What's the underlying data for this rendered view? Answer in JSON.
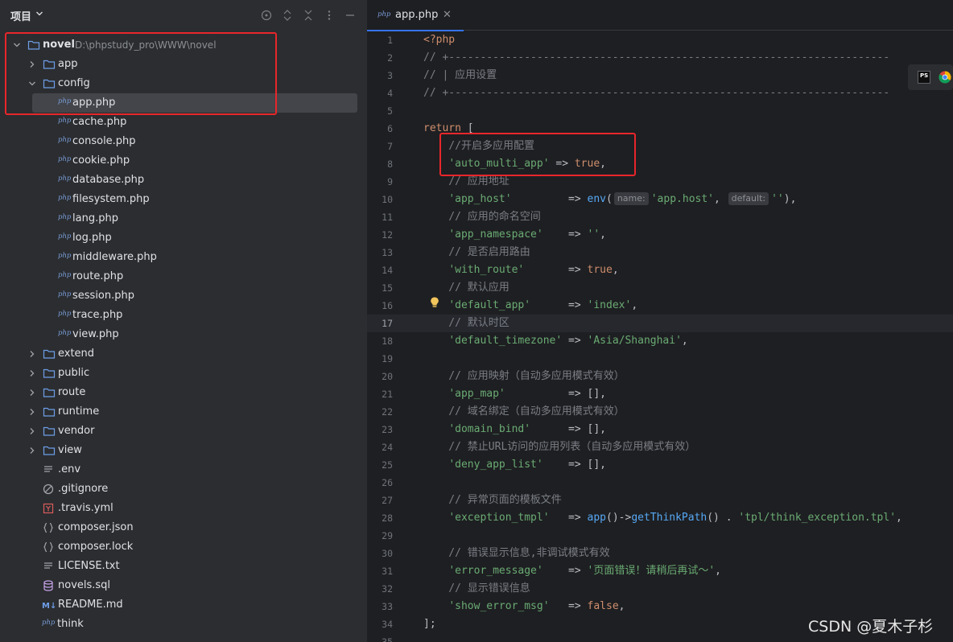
{
  "panel": {
    "title": "项目",
    "tree": [
      {
        "label": "novel",
        "path": "D:\\phpstudy_pro\\WWW\\novel",
        "type": "folder",
        "expanded": true
      },
      {
        "label": "app",
        "type": "folder",
        "expanded": false
      },
      {
        "label": "config",
        "type": "folder",
        "expanded": true
      },
      {
        "label": "app.php",
        "type": "php",
        "selected": true
      },
      {
        "label": "cache.php",
        "type": "php"
      },
      {
        "label": "console.php",
        "type": "php"
      },
      {
        "label": "cookie.php",
        "type": "php"
      },
      {
        "label": "database.php",
        "type": "php"
      },
      {
        "label": "filesystem.php",
        "type": "php"
      },
      {
        "label": "lang.php",
        "type": "php"
      },
      {
        "label": "log.php",
        "type": "php"
      },
      {
        "label": "middleware.php",
        "type": "php"
      },
      {
        "label": "route.php",
        "type": "php"
      },
      {
        "label": "session.php",
        "type": "php"
      },
      {
        "label": "trace.php",
        "type": "php"
      },
      {
        "label": "view.php",
        "type": "php"
      },
      {
        "label": "extend",
        "type": "folder",
        "expanded": false
      },
      {
        "label": "public",
        "type": "folder",
        "expanded": false
      },
      {
        "label": "route",
        "type": "folder",
        "expanded": false
      },
      {
        "label": "runtime",
        "type": "folder",
        "expanded": false
      },
      {
        "label": "vendor",
        "type": "folder",
        "expanded": false
      },
      {
        "label": "view",
        "type": "folder",
        "expanded": false
      },
      {
        "label": ".env",
        "type": "text"
      },
      {
        "label": ".gitignore",
        "type": "ignore"
      },
      {
        "label": ".travis.yml",
        "type": "yaml"
      },
      {
        "label": "composer.json",
        "type": "json"
      },
      {
        "label": "composer.lock",
        "type": "json"
      },
      {
        "label": "LICENSE.txt",
        "type": "text"
      },
      {
        "label": "novels.sql",
        "type": "sql"
      },
      {
        "label": "README.md",
        "type": "markdown"
      },
      {
        "label": "think",
        "type": "php-script"
      }
    ]
  },
  "editor": {
    "tab": {
      "label": "app.php",
      "icon_text": "php"
    },
    "current_line": 17,
    "lines": [
      {
        "n": 1,
        "tokens": [
          {
            "t": "<?php",
            "c": "tag"
          }
        ]
      },
      {
        "n": 2,
        "tokens": [
          {
            "t": "// +----------------------------------------------------------------------",
            "c": "cm"
          }
        ]
      },
      {
        "n": 3,
        "tokens": [
          {
            "t": "// | 应用设置",
            "c": "cm"
          }
        ]
      },
      {
        "n": 4,
        "tokens": [
          {
            "t": "// +----------------------------------------------------------------------",
            "c": "cm"
          }
        ]
      },
      {
        "n": 5,
        "tokens": []
      },
      {
        "n": 6,
        "tokens": [
          {
            "t": "return",
            "c": "kw"
          },
          {
            "t": " [",
            "c": "def"
          }
        ]
      },
      {
        "n": 7,
        "tokens": [
          {
            "t": "    //开启多应用配置",
            "c": "cm"
          }
        ]
      },
      {
        "n": 8,
        "tokens": [
          {
            "t": "    ",
            "c": "def"
          },
          {
            "t": "'auto_multi_app'",
            "c": "str"
          },
          {
            "t": " => ",
            "c": "def"
          },
          {
            "t": "true",
            "c": "kw"
          },
          {
            "t": ",",
            "c": "def"
          }
        ]
      },
      {
        "n": 9,
        "tokens": [
          {
            "t": "    // 应用地址",
            "c": "cm"
          }
        ]
      },
      {
        "n": 10,
        "tokens": [
          {
            "t": "    ",
            "c": "def"
          },
          {
            "t": "'app_host'",
            "c": "str"
          },
          {
            "t": "         => ",
            "c": "def"
          },
          {
            "t": "env",
            "c": "fn"
          },
          {
            "t": "(",
            "c": "def"
          },
          {
            "hint": "name:"
          },
          {
            "t": "'app.host'",
            "c": "str"
          },
          {
            "t": ", ",
            "c": "def"
          },
          {
            "hint": "default:"
          },
          {
            "t": "''",
            "c": "str"
          },
          {
            "t": "),",
            "c": "def"
          }
        ]
      },
      {
        "n": 11,
        "tokens": [
          {
            "t": "    // 应用的命名空间",
            "c": "cm"
          }
        ]
      },
      {
        "n": 12,
        "tokens": [
          {
            "t": "    ",
            "c": "def"
          },
          {
            "t": "'app_namespace'",
            "c": "str"
          },
          {
            "t": "    => ",
            "c": "def"
          },
          {
            "t": "''",
            "c": "str"
          },
          {
            "t": ",",
            "c": "def"
          }
        ]
      },
      {
        "n": 13,
        "tokens": [
          {
            "t": "    // 是否启用路由",
            "c": "cm"
          }
        ]
      },
      {
        "n": 14,
        "tokens": [
          {
            "t": "    ",
            "c": "def"
          },
          {
            "t": "'with_route'",
            "c": "str"
          },
          {
            "t": "       => ",
            "c": "def"
          },
          {
            "t": "true",
            "c": "kw"
          },
          {
            "t": ",",
            "c": "def"
          }
        ]
      },
      {
        "n": 15,
        "tokens": [
          {
            "t": "    // 默认应用",
            "c": "cm"
          }
        ]
      },
      {
        "n": 16,
        "tokens": [
          {
            "t": "    ",
            "c": "def"
          },
          {
            "t": "'default_app'",
            "c": "str"
          },
          {
            "t": "      => ",
            "c": "def"
          },
          {
            "t": "'index'",
            "c": "str"
          },
          {
            "t": ",",
            "c": "def"
          }
        ]
      },
      {
        "n": 17,
        "tokens": [
          {
            "t": "    // 默认时区",
            "c": "cm"
          }
        ]
      },
      {
        "n": 18,
        "tokens": [
          {
            "t": "    ",
            "c": "def"
          },
          {
            "t": "'default_timezone'",
            "c": "str"
          },
          {
            "t": " => ",
            "c": "def"
          },
          {
            "t": "'Asia/Shanghai'",
            "c": "str"
          },
          {
            "t": ",",
            "c": "def"
          }
        ]
      },
      {
        "n": 19,
        "tokens": []
      },
      {
        "n": 20,
        "tokens": [
          {
            "t": "    // 应用映射（自动多应用模式有效）",
            "c": "cm"
          }
        ]
      },
      {
        "n": 21,
        "tokens": [
          {
            "t": "    ",
            "c": "def"
          },
          {
            "t": "'app_map'",
            "c": "str"
          },
          {
            "t": "          => [],",
            "c": "def"
          }
        ]
      },
      {
        "n": 22,
        "tokens": [
          {
            "t": "    // 域名绑定（自动多应用模式有效）",
            "c": "cm"
          }
        ]
      },
      {
        "n": 23,
        "tokens": [
          {
            "t": "    ",
            "c": "def"
          },
          {
            "t": "'domain_bind'",
            "c": "str"
          },
          {
            "t": "      => [],",
            "c": "def"
          }
        ]
      },
      {
        "n": 24,
        "tokens": [
          {
            "t": "    // 禁止URL访问的应用列表（自动多应用模式有效）",
            "c": "cm"
          }
        ]
      },
      {
        "n": 25,
        "tokens": [
          {
            "t": "    ",
            "c": "def"
          },
          {
            "t": "'deny_app_list'",
            "c": "str"
          },
          {
            "t": "    => [],",
            "c": "def"
          }
        ]
      },
      {
        "n": 26,
        "tokens": []
      },
      {
        "n": 27,
        "tokens": [
          {
            "t": "    // 异常页面的模板文件",
            "c": "cm"
          }
        ]
      },
      {
        "n": 28,
        "tokens": [
          {
            "t": "    ",
            "c": "def"
          },
          {
            "t": "'exception_tmpl'",
            "c": "str"
          },
          {
            "t": "   => ",
            "c": "def"
          },
          {
            "t": "app",
            "c": "fn"
          },
          {
            "t": "()->",
            "c": "def"
          },
          {
            "t": "getThinkPath",
            "c": "fn"
          },
          {
            "t": "() . ",
            "c": "def"
          },
          {
            "t": "'tpl/think_exception.tpl'",
            "c": "str"
          },
          {
            "t": ",",
            "c": "def"
          }
        ]
      },
      {
        "n": 29,
        "tokens": []
      },
      {
        "n": 30,
        "tokens": [
          {
            "t": "    // 错误显示信息,非调试模式有效",
            "c": "cm"
          }
        ]
      },
      {
        "n": 31,
        "tokens": [
          {
            "t": "    ",
            "c": "def"
          },
          {
            "t": "'error_message'",
            "c": "str"
          },
          {
            "t": "    => ",
            "c": "def"
          },
          {
            "t": "'页面错误！请稍后再试～'",
            "c": "str"
          },
          {
            "t": ",",
            "c": "def"
          }
        ]
      },
      {
        "n": 32,
        "tokens": [
          {
            "t": "    // 显示错误信息",
            "c": "cm"
          }
        ]
      },
      {
        "n": 33,
        "tokens": [
          {
            "t": "    ",
            "c": "def"
          },
          {
            "t": "'show_error_msg'",
            "c": "str"
          },
          {
            "t": "   => ",
            "c": "def"
          },
          {
            "t": "false",
            "c": "kw"
          },
          {
            "t": ",",
            "c": "def"
          }
        ]
      },
      {
        "n": 34,
        "tokens": [
          {
            "t": "];",
            "c": "def"
          }
        ]
      },
      {
        "n": 35,
        "tokens": []
      }
    ]
  },
  "right_tools": {
    "ps_text": "PS"
  },
  "watermark": "CSDN @夏木子杉",
  "colors": {
    "accent": "#3574f0",
    "annotation_red": "#e8262b",
    "folder": "#6e9ee8"
  }
}
